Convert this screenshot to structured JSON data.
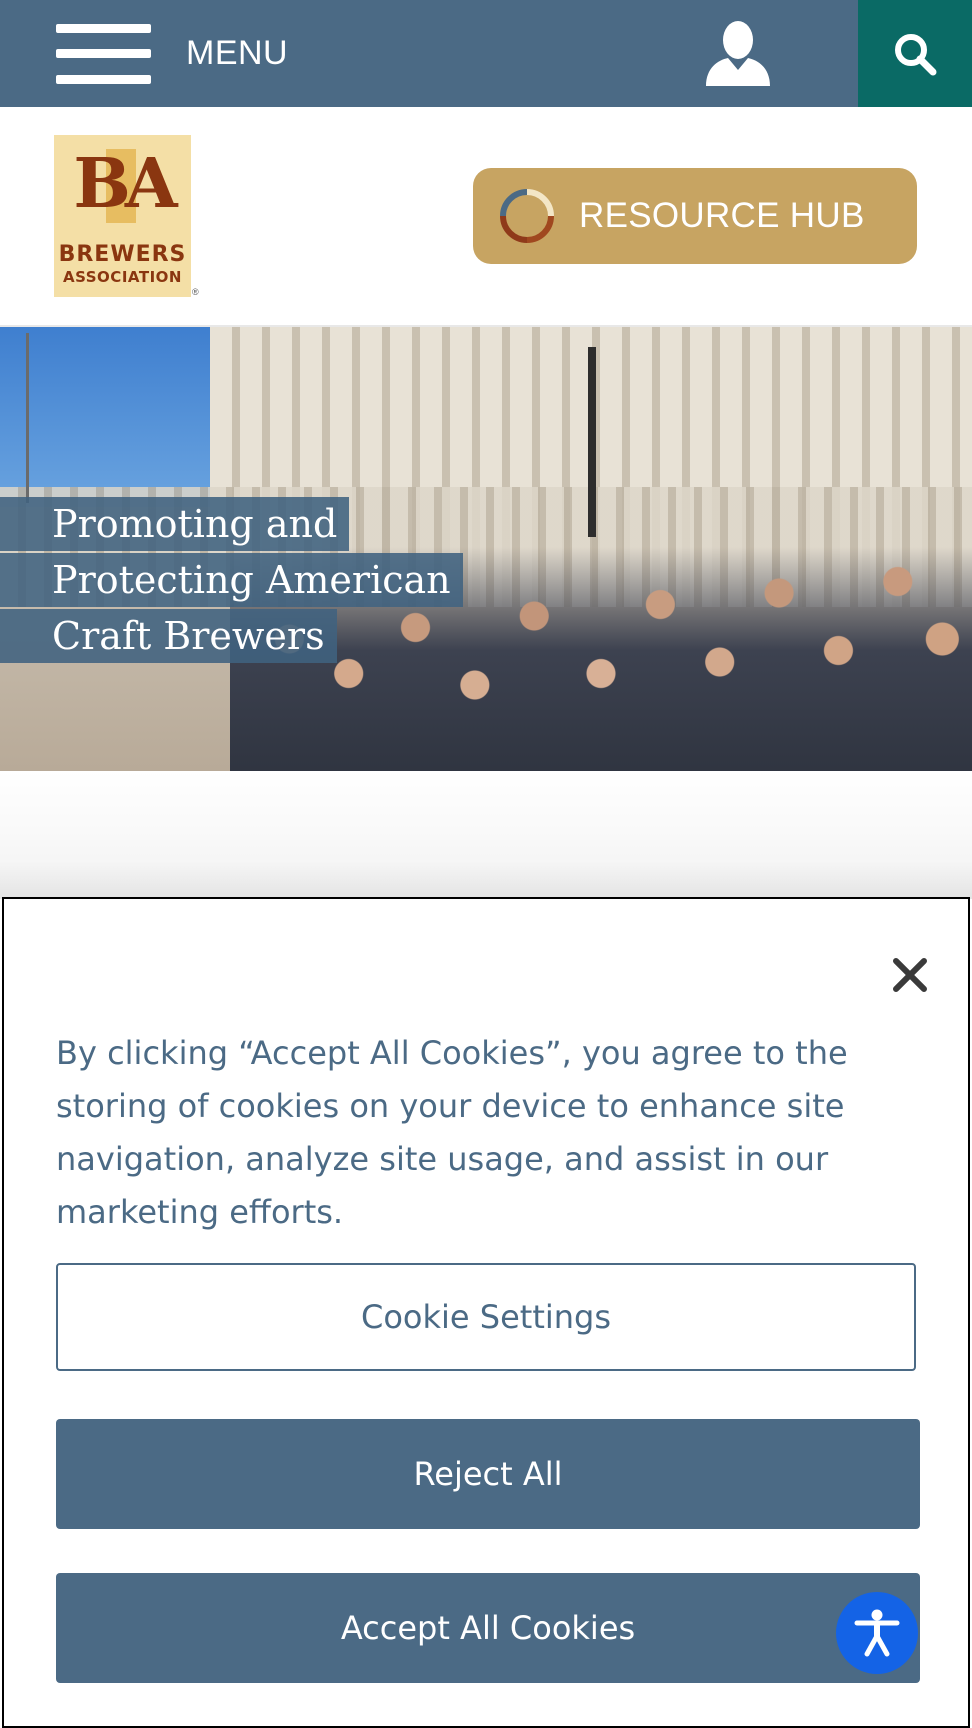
{
  "topnav": {
    "menu_label": "MENU",
    "icons": {
      "menu": "hamburger-icon",
      "user": "user-icon",
      "search": "search-icon"
    },
    "colors": {
      "bar": "#4b6a85",
      "search_bg": "#0a6a65"
    }
  },
  "header": {
    "logo": {
      "letters": "BA",
      "line1": "BREWERS",
      "line2": "ASSOCIATION",
      "registered": "®"
    },
    "resource_hub_label": "RESOURCE HUB",
    "colors": {
      "resource_bg": "#c7a462"
    }
  },
  "hero": {
    "title_lines": [
      "Promoting and",
      "Protecting American",
      "Craft Brewers"
    ]
  },
  "cookie_banner": {
    "text": "By clicking “Accept All Cookies”, you agree to the storing of cookies on your device to enhance site navigation, analyze site usage, and assist in our marketing efforts.",
    "settings_label": "Cookie Settings",
    "reject_label": "Reject All",
    "accept_label": "Accept All Cookies",
    "close_icon": "close-icon",
    "colors": {
      "primary": "#4b6a85"
    }
  },
  "accessibility": {
    "icon": "accessibility-icon",
    "color": "#1463e6"
  }
}
